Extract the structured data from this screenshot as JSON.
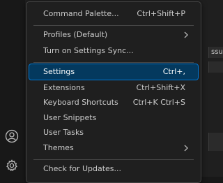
{
  "menu": {
    "items": [
      {
        "label": "Command Palette...",
        "shortcut": "Ctrl+Shift+P"
      },
      {
        "label": "Profiles (Default)",
        "submenu_icon": "chevron-right-icon"
      },
      {
        "label": "Turn on Settings Sync..."
      },
      {
        "label": "Settings",
        "shortcut": "Ctrl+,",
        "selected": true
      },
      {
        "label": "Extensions",
        "shortcut": "Ctrl+Shift+X"
      },
      {
        "label": "Keyboard Shortcuts",
        "shortcut": "Ctrl+K Ctrl+S"
      },
      {
        "label": "User Snippets"
      },
      {
        "label": "User Tasks"
      },
      {
        "label": "Themes",
        "submenu_icon": "chevron-right-icon"
      },
      {
        "label": "Check for Updates..."
      }
    ]
  },
  "background": {
    "partial_tab_text": "ssue"
  },
  "activity_bar": {
    "icons": [
      "account-icon",
      "manage-gear-icon"
    ]
  },
  "colors": {
    "menu_background": "#1f1f1f",
    "selected_background": "#04395e",
    "selected_border": "#0078d4",
    "text": "#cccccc",
    "separator": "#454545"
  }
}
